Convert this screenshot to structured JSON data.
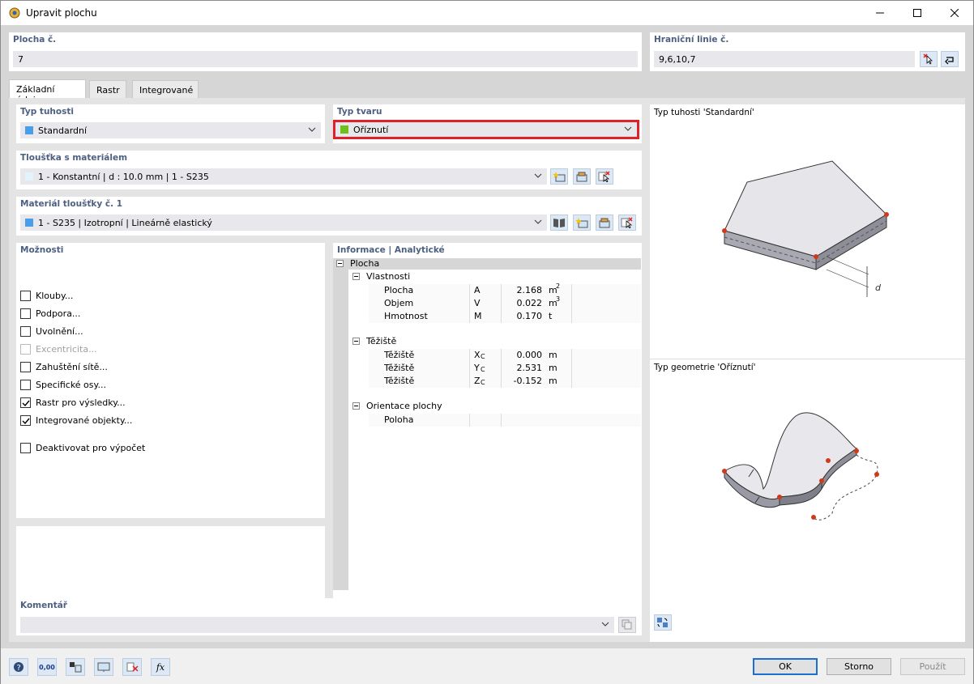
{
  "window": {
    "title": "Upravit plochu"
  },
  "surface_no": {
    "label": "Plocha č.",
    "value": "7"
  },
  "boundary_lines": {
    "label": "Hraniční linie č.",
    "value": "9,6,10,7"
  },
  "tabs": [
    {
      "label": "Základní údaje"
    },
    {
      "label": "Rastr"
    },
    {
      "label": "Integrované"
    }
  ],
  "stiffness": {
    "label": "Typ tuhosti",
    "value": "Standardní",
    "color": "#4a9de8"
  },
  "shape": {
    "label": "Typ tvaru",
    "value": "Oříznutí",
    "color": "#6fbf1f",
    "highlight": "#e0202a"
  },
  "thickness": {
    "label": "Tloušťka s materiálem",
    "value": "1 - Konstantní | d : 10.0 mm | 1 - S235",
    "color": "#dff4fb"
  },
  "material": {
    "label": "Materiál tloušťky č. 1",
    "value": "1 - S235 | Izotropní | Lineárně elastický",
    "color": "#4a9de8"
  },
  "options": {
    "label": "Možnosti",
    "items": [
      {
        "label": "Klouby...",
        "checked": false,
        "disabled": false
      },
      {
        "label": "Podpora...",
        "checked": false,
        "disabled": false
      },
      {
        "label": "Uvolnění...",
        "checked": false,
        "disabled": false
      },
      {
        "label": "Excentricita...",
        "checked": false,
        "disabled": true
      },
      {
        "label": "Zahuštění sítě...",
        "checked": false,
        "disabled": false
      },
      {
        "label": "Specifické osy...",
        "checked": false,
        "disabled": false
      },
      {
        "label": "Rastr pro výsledky...",
        "checked": true,
        "disabled": false
      },
      {
        "label": "Integrované objekty...",
        "checked": true,
        "disabled": false
      },
      {
        "label": "Deaktivovat pro výpočet",
        "checked": false,
        "disabled": false
      }
    ]
  },
  "info": {
    "label": "Informace | Analytické",
    "root": "Plocha",
    "props": {
      "label": "Vlastnosti",
      "rows": [
        {
          "name": "Plocha",
          "sym": "A",
          "val": "2.168",
          "unit": "m",
          "sup": "2"
        },
        {
          "name": "Objem",
          "sym": "V",
          "val": "0.022",
          "unit": "m",
          "sup": "3"
        },
        {
          "name": "Hmotnost",
          "sym": "M",
          "val": "0.170",
          "unit": "t",
          "sup": ""
        }
      ]
    },
    "centroid": {
      "label": "Těžiště",
      "rows": [
        {
          "name": "Těžiště",
          "sym": "X",
          "sub": "C",
          "val": "0.000",
          "unit": "m"
        },
        {
          "name": "Těžiště",
          "sym": "Y",
          "sub": "C",
          "val": "2.531",
          "unit": "m"
        },
        {
          "name": "Těžiště",
          "sym": "Z",
          "sub": "C",
          "val": "-0.152",
          "unit": "m"
        }
      ]
    },
    "orient": {
      "label": "Orientace plochy",
      "rows": [
        {
          "name": "Poloha"
        }
      ]
    }
  },
  "preview": {
    "stiffness_title": "Typ tuhosti 'Standardní'",
    "geometry_title": "Typ geometrie 'Oříznutí'",
    "d_label": "d"
  },
  "comment": {
    "label": "Komentář",
    "value": ""
  },
  "buttons": {
    "ok": "OK",
    "cancel": "Storno",
    "apply": "Použít"
  },
  "footer_icons": [
    "help-icon",
    "units-icon",
    "text-icon",
    "view-icon",
    "deselect-icon",
    "formula-icon"
  ],
  "units_text": "0,00"
}
